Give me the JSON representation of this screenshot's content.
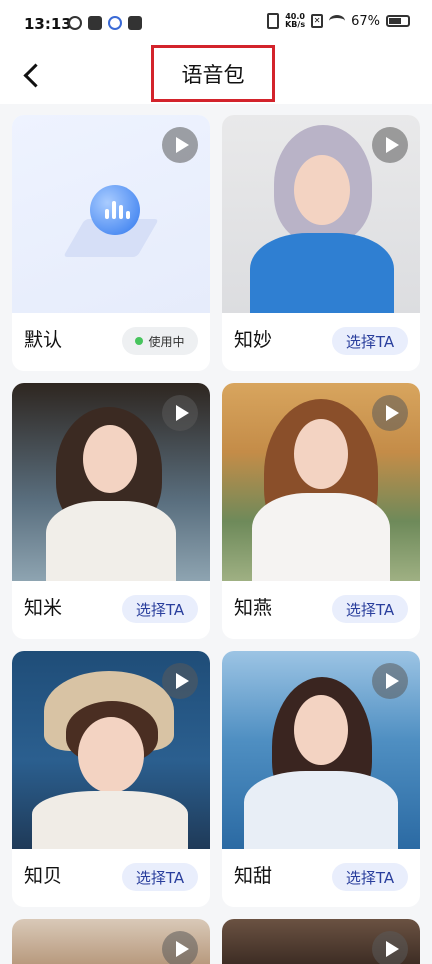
{
  "status_bar": {
    "time": "13:13",
    "net_speed_value": "40.0",
    "net_speed_unit": "KB/s",
    "battery_percent_text": "67%",
    "battery_level": 0.67
  },
  "navbar": {
    "title": "语音包"
  },
  "voices": [
    {
      "name": "默认",
      "status": "使用中",
      "icon": "voice-app-logo"
    },
    {
      "name": "知妙",
      "action": "选择TA"
    },
    {
      "name": "知米",
      "action": "选择TA"
    },
    {
      "name": "知燕",
      "action": "选择TA"
    },
    {
      "name": "知贝",
      "action": "选择TA"
    },
    {
      "name": "知甜",
      "action": "选择TA"
    }
  ],
  "colors": {
    "accent_text": "#2a3f9d",
    "button_bg": "#e9eefc",
    "inuse_dot": "#47c45d",
    "highlight_border": "#d3232b"
  }
}
